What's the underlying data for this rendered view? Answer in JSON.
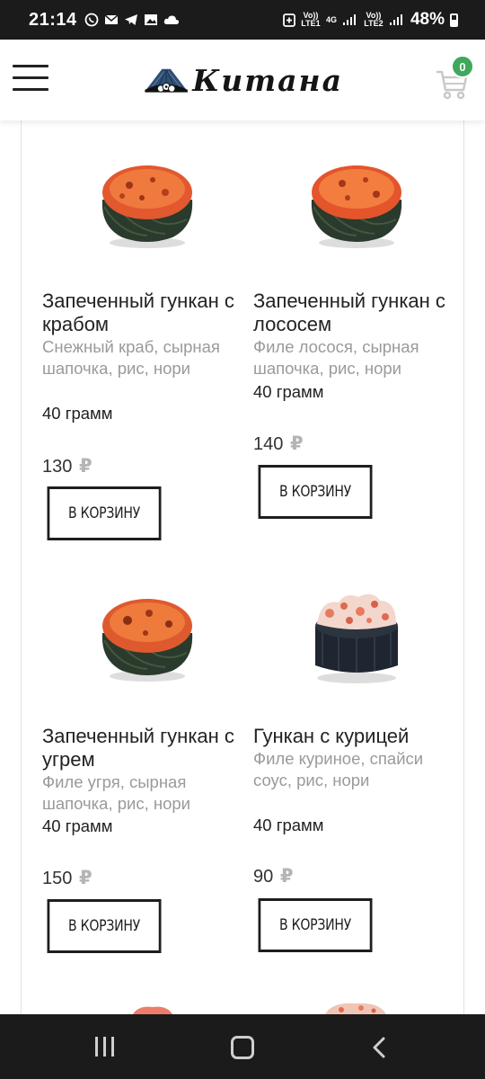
{
  "status_bar": {
    "time": "21:14",
    "sim1_label": "Vo)) LTE1",
    "net_label": "4G",
    "sim2_label": "Vo)) LTE2",
    "battery": "48%",
    "icons": [
      "viber-icon",
      "mail-icon",
      "telegram-icon",
      "gallery-icon",
      "cloud-icon"
    ]
  },
  "header": {
    "logo_text": "Китана",
    "cart_count": "0",
    "brand_color": "#3fa85c",
    "logo_blue": "#2f4f76"
  },
  "products": [
    {
      "name": "Запеченный гункан с крабом",
      "description": "Снежный краб, сырная шапочка, рис, нори",
      "weight": "40 грамм",
      "price": "130",
      "currency": "₽",
      "button": "В КОРЗИНУ",
      "image": "baked-gunkan-image"
    },
    {
      "name": "Запеченный гункан с лососем",
      "description": "Филе лосося, сырная шапочка, рис, нори",
      "weight": "40 грамм",
      "price": "140",
      "currency": "₽",
      "button": "В КОРЗИНУ",
      "image": "baked-gunkan-image"
    },
    {
      "name": "Запеченный гункан с угрем",
      "description": "Филе угря, сырная шапочка, рис, нори",
      "weight": "40 грамм",
      "price": "150",
      "currency": "₽",
      "button": "В КОРЗИНУ",
      "image": "baked-gunkan-image"
    },
    {
      "name": "Гункан с курицей",
      "description": "Филе куриное, спайси соус, рис, нори",
      "weight": "40 грамм",
      "price": "90",
      "currency": "₽",
      "button": "В КОРЗИНУ",
      "image": "chicken-gunkan-image"
    }
  ],
  "nav": {
    "icons": [
      "recent-apps-icon",
      "home-icon",
      "back-icon"
    ]
  }
}
